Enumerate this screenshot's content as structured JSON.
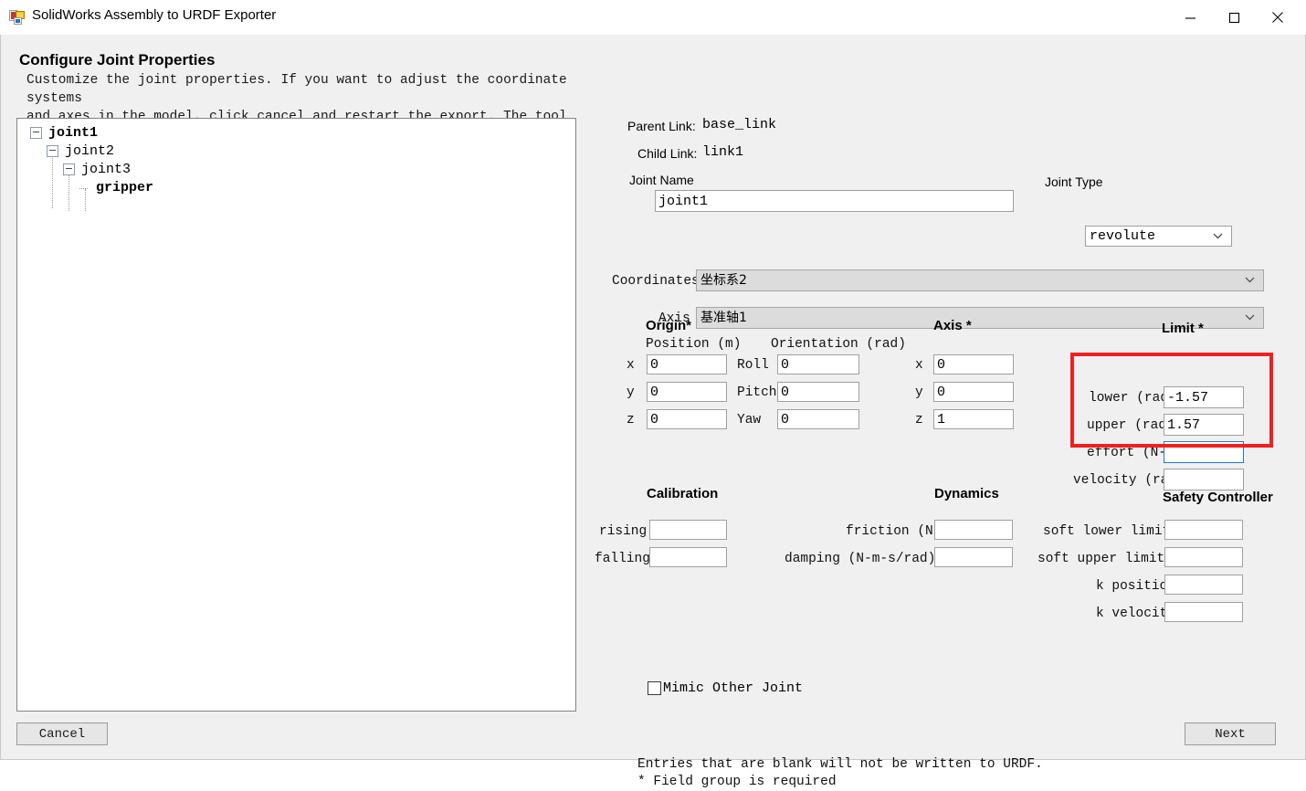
{
  "window": {
    "title": "SolidWorks Assembly to URDF Exporter",
    "icon": "app-icon",
    "minimize": "minimize-icon",
    "maximize": "maximize-icon",
    "close": "close-icon"
  },
  "page": {
    "title": "Configure Joint Properties",
    "description": "Customize the joint properties. If you want to adjust the coordinate systems\nand axes in the model, click cancel and restart the export. The tool will\nrecognize your changes on the next run."
  },
  "tree": {
    "nodes": [
      {
        "label": "joint1",
        "depth": 0,
        "expanded": true,
        "bold": true
      },
      {
        "label": "joint2",
        "depth": 1,
        "expanded": true,
        "bold": false
      },
      {
        "label": "joint3",
        "depth": 2,
        "expanded": true,
        "bold": false
      },
      {
        "label": "gripper",
        "depth": 3,
        "expanded": false,
        "bold": true
      }
    ]
  },
  "form": {
    "parent_link_label": "Parent Link:",
    "parent_link_value": "base_link",
    "child_link_label": "Child Link:",
    "child_link_value": "link1",
    "joint_name_label": "Joint Name",
    "joint_name_value": "joint1",
    "joint_type_label": "Joint Type",
    "joint_type_value": "revolute",
    "coordinates_label": "Coordinates",
    "coordinates_value": "坐标系2",
    "axis_ref_label": "Axis",
    "axis_ref_value": "基准轴1"
  },
  "origin": {
    "heading": "Origin*",
    "position_label": "Position (m)",
    "orientation_label": "Orientation (rad)",
    "position": [
      {
        "axis": "x",
        "value": "0"
      },
      {
        "axis": "y",
        "value": "0"
      },
      {
        "axis": "z",
        "value": "0"
      }
    ],
    "orientation": [
      {
        "axis": "Roll",
        "value": "0"
      },
      {
        "axis": "Pitch",
        "value": "0"
      },
      {
        "axis": "Yaw",
        "value": "0"
      }
    ]
  },
  "axis": {
    "heading": "Axis *",
    "rows": [
      {
        "axis": "x",
        "value": "0"
      },
      {
        "axis": "y",
        "value": "0"
      },
      {
        "axis": "z",
        "value": "1"
      }
    ]
  },
  "limit": {
    "heading": "Limit *",
    "rows": [
      {
        "label": "lower (rad)",
        "value": "-1.57",
        "focused": false
      },
      {
        "label": "upper (rad)",
        "value": "1.57",
        "focused": false
      },
      {
        "label": "effort (N-m)",
        "value": "",
        "focused": true
      },
      {
        "label": "velocity (rad/s)",
        "value": "",
        "focused": false
      }
    ]
  },
  "calibration": {
    "heading": "Calibration",
    "rows": [
      {
        "label": "rising",
        "value": ""
      },
      {
        "label": "falling",
        "value": ""
      }
    ]
  },
  "dynamics": {
    "heading": "Dynamics",
    "rows": [
      {
        "label": "friction (N-m)",
        "value": ""
      },
      {
        "label": "damping (N-m-s/rad)",
        "value": ""
      }
    ]
  },
  "safety": {
    "heading": "Safety Controller",
    "rows": [
      {
        "label": "soft lower limit",
        "value": ""
      },
      {
        "label": "soft upper limit",
        "value": ""
      },
      {
        "label": "k position",
        "value": ""
      },
      {
        "label": "k velocity",
        "value": ""
      }
    ]
  },
  "mimic": {
    "label": "Mimic Other Joint",
    "checked": false
  },
  "footer": {
    "note": "Entries that are blank will not be written to URDF.\n* Field group is required",
    "cancel_label": "Cancel",
    "next_label": "Next"
  },
  "colors": {
    "window_bg": "#f0f0f0",
    "panel_white": "#ffffff",
    "annotation_red": "#ef2020",
    "focus_blue": "#1e7ac8",
    "disabled_combo": "#dcdcdc"
  }
}
